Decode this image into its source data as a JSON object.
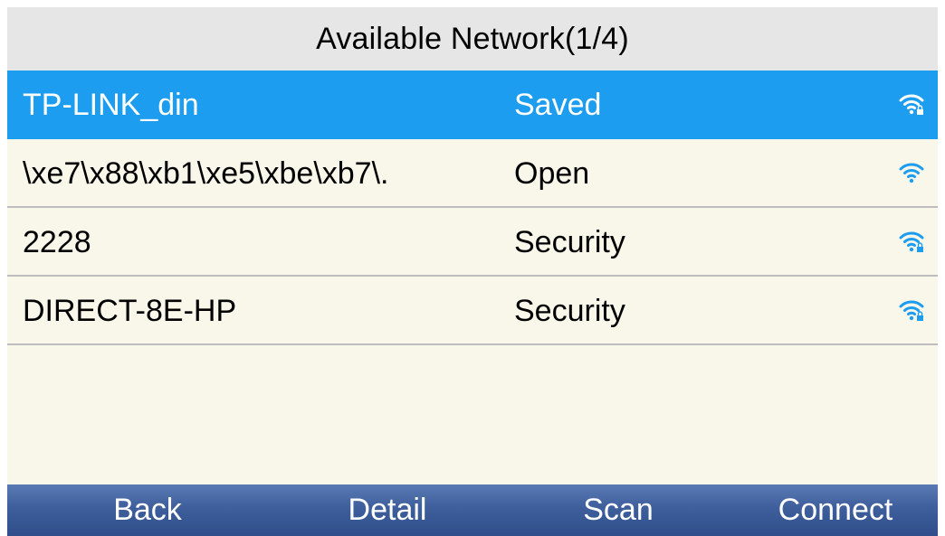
{
  "header": {
    "title": "Available Network(1/4)"
  },
  "networks": [
    {
      "name": "TP-LINK_din",
      "status": "Saved",
      "icon": "wifi-locked-icon",
      "selected": true
    },
    {
      "name": "\\xe7\\x88\\xb1\\xe5\\xbe\\xb7\\.",
      "status": "Open",
      "icon": "wifi-icon",
      "selected": false
    },
    {
      "name": "2228",
      "status": "Security",
      "icon": "wifi-locked-icon",
      "selected": false
    },
    {
      "name": "DIRECT-8E-HP",
      "status": "Security",
      "icon": "wifi-locked-icon",
      "selected": false
    }
  ],
  "softkeys": {
    "back": "Back",
    "detail": "Detail",
    "scan": "Scan",
    "connect": "Connect"
  },
  "colors": {
    "selected_row": "#1d9df0",
    "wifi_icon": "#1d9df0",
    "list_background": "#f8f7e9",
    "softkey_bar": "#3e5f9c"
  }
}
